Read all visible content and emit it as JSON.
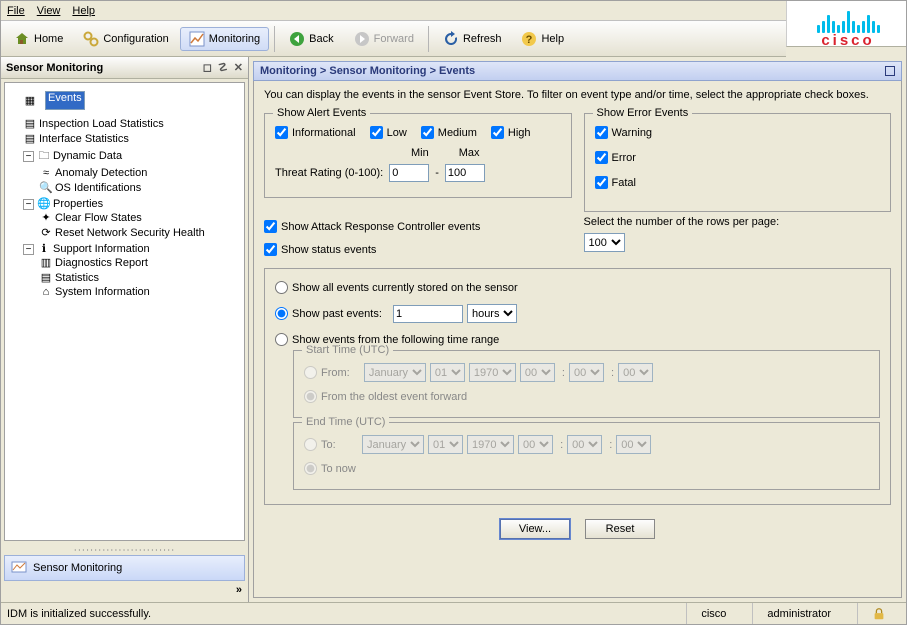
{
  "menubar": {
    "file": "File",
    "view": "View",
    "help": "Help"
  },
  "toolbar": {
    "home": "Home",
    "configuration": "Configuration",
    "monitoring": "Monitoring",
    "back": "Back",
    "forward": "Forward",
    "refresh": "Refresh",
    "help": "Help"
  },
  "logo_text": "cisco",
  "sidebar": {
    "title": "Sensor Monitoring",
    "nodes": {
      "events": "Events",
      "inspection": "Inspection Load Statistics",
      "interface": "Interface Statistics",
      "dynamic": "Dynamic Data",
      "anomaly": "Anomaly Detection",
      "osid": "OS Identifications",
      "properties": "Properties",
      "clearflow": "Clear Flow States",
      "resetnet": "Reset Network Security Health",
      "support": "Support Information",
      "diag": "Diagnostics Report",
      "stats": "Statistics",
      "sysinfo": "System Information"
    },
    "footer": "Sensor Monitoring"
  },
  "main": {
    "breadcrumb": "Monitoring > Sensor Monitoring > Events",
    "intro": "You can display the events in the sensor Event Store. To filter on event type and/or time, select the appropriate check boxes.",
    "alert_legend": "Show Alert Events",
    "error_legend": "Show Error Events",
    "chk_informational": "Informational",
    "chk_low": "Low",
    "chk_medium": "Medium",
    "chk_high": "High",
    "chk_warning": "Warning",
    "chk_error": "Error",
    "chk_fatal": "Fatal",
    "min": "Min",
    "max": "Max",
    "threat_label": "Threat Rating (0-100):",
    "threat_min": "0",
    "threat_max": "100",
    "chk_arc": "Show Attack Response Controller events",
    "chk_status": "Show status events",
    "rows_label": "Select the number of the rows per page:",
    "rows_value": "100",
    "r_all": "Show all events currently stored on the sensor",
    "r_past": "Show past events:",
    "past_value": "1",
    "past_unit": "hours",
    "r_range": "Show events from the following time range",
    "start_legend": "Start Time (UTC)",
    "end_legend": "End Time (UTC)",
    "r_from": "From:",
    "r_oldest": "From the oldest event forward",
    "r_to": "To:",
    "r_now": "To now",
    "month": "January",
    "day": "01",
    "year": "1970",
    "hh": "00",
    "mm": "00",
    "ss": "00",
    "btn_view": "View...",
    "btn_reset": "Reset"
  },
  "status": {
    "left": "IDM is initialized successfully.",
    "user1": "cisco",
    "user2": "administrator"
  }
}
